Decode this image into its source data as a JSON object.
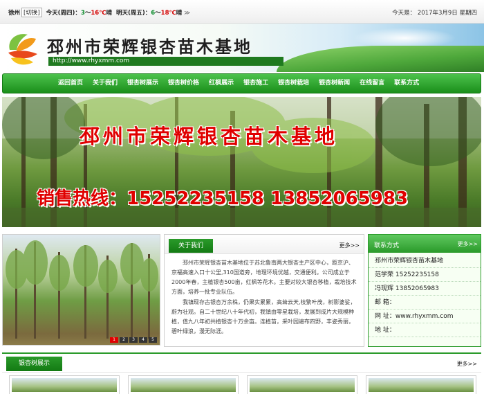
{
  "weather": {
    "city": "徐州",
    "switch_label": "[切换]",
    "today_label": "今天(周四)：",
    "today_low": "3",
    "today_sep": "～",
    "today_high": "16℃",
    "today_cond": "晴",
    "tomorrow_label": "明天(周五)：",
    "tomorrow_low": "6",
    "tomorrow_sep": "～",
    "tomorrow_high": "18℃",
    "tomorrow_cond": "晴",
    "more": "≫"
  },
  "date_text": "今天是： 2017年3月9日 星期四",
  "header": {
    "title": "邳州市荣辉银杏苗木基地",
    "url": "http://www.rhyxmm.com"
  },
  "nav": [
    "返回首页",
    "关于我们",
    "银杏树展示",
    "银杏树价格",
    "红枫展示",
    "银杏施工",
    "银杏树栽培",
    "银杏树新闻",
    "在线留言",
    "联系方式"
  ],
  "banner": {
    "title": "邳州市荣辉银杏苗木基地",
    "hotline": "销售热线：15252235158 13852065983"
  },
  "slider_dots": [
    "1",
    "2",
    "3",
    "4",
    "5"
  ],
  "about": {
    "tab": "关于我们",
    "more": "更多>>",
    "para1": "邳州市荣辉银杏苗木基地位于苏北鲁南两大银杏主产区中心，距京沪、京福高速入口十公里,310国道旁，地理环境优越，交通便利。公司成立于2000年春，主植银杏500亩，红枫等花木。主要对较大银杏移植，栽培技术方面，培养一批专业队伍。",
    "para2": "我镇现存古银杏万余株，仍果实累累，高耸云天,枝繁叶茂，树影婆娑，蔚为壮观。自二十世纪八十年代初，我镇由零星栽培，发展到成片大规模种植，值九八年初共植银杏十万余亩。连植苗，采叶园遍布四野，丰姿秀丽，碧叶绿浪，漫无际涯。"
  },
  "contact": {
    "title": "联系方式",
    "more": "更多>>",
    "items": [
      "邳州市荣辉银杏苗木基地",
      "范学荣 15252235158",
      "冯现辉 13852065983",
      "邮 箱：",
      "网 址：www.rhyxmm.com",
      "地 址："
    ]
  },
  "gallery": {
    "tab": "银杏树展示",
    "more": "更多>>"
  },
  "colors": {
    "brand_green": "#1b8f1b",
    "hotline_red": "#e00000"
  }
}
